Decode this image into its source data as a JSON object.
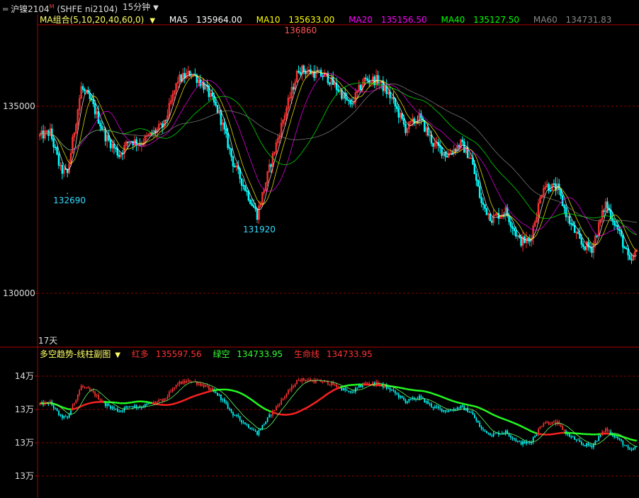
{
  "header": {
    "symbol_icon": "chain-link-icon",
    "title": "沪镍2104",
    "title_mark": "M",
    "exchange_code": "(SHFE ni2104)",
    "period": "15分钟",
    "period_dropdown_icon": "chevron-down-icon"
  },
  "ma_indicator": {
    "name": "MA组合(5,10,20,40,60,0)",
    "items": [
      {
        "label": "MA5",
        "value": "135964.00",
        "color": "#ffffff"
      },
      {
        "label": "MA10",
        "value": "135633.00",
        "color": "#ffff00"
      },
      {
        "label": "MA20",
        "value": "135156.50",
        "color": "#ff00ff"
      },
      {
        "label": "MA40",
        "value": "135127.50",
        "color": "#00ff00"
      },
      {
        "label": "MA60",
        "value": "134731.83",
        "color": "#888888"
      }
    ]
  },
  "main_axis": {
    "ticks": [
      {
        "value": 135000,
        "label": "135000"
      },
      {
        "value": 130000,
        "label": "130000"
      }
    ]
  },
  "annotations": {
    "high": {
      "label": "136860",
      "value": 136860
    },
    "low1": {
      "label": "132690",
      "value": 132690
    },
    "low2": {
      "label": "131920",
      "value": 131920
    },
    "days": "17天"
  },
  "sub_indicator": {
    "name": "多空趋势-线柱副图",
    "items": [
      {
        "label": "红多",
        "value": "135597.56",
        "color": "#ff3333"
      },
      {
        "label": "绿空",
        "value": "134733.95",
        "color": "#33ff33"
      },
      {
        "label": "生命线",
        "value": "134733.95",
        "color": "#ff3333"
      }
    ],
    "axis_labels": [
      "14万",
      "13万",
      "13万",
      "13万"
    ]
  },
  "colors": {
    "up": "#ff3333",
    "down": "#00ffff",
    "grid": "#8b0000",
    "axis": "#b00000"
  },
  "chart_data": {
    "type": "candlestick",
    "ylim": [
      129800,
      137000
    ],
    "waypoints": [
      [
        0,
        134200
      ],
      [
        6,
        134300
      ],
      [
        12,
        133300
      ],
      [
        16,
        133200
      ],
      [
        24,
        135500
      ],
      [
        30,
        135100
      ],
      [
        38,
        134200
      ],
      [
        46,
        133700
      ],
      [
        52,
        134100
      ],
      [
        58,
        134000
      ],
      [
        66,
        134300
      ],
      [
        72,
        134500
      ],
      [
        80,
        135700
      ],
      [
        88,
        135900
      ],
      [
        96,
        135500
      ],
      [
        104,
        134800
      ],
      [
        112,
        133500
      ],
      [
        120,
        132700
      ],
      [
        126,
        132100
      ],
      [
        134,
        133500
      ],
      [
        142,
        134800
      ],
      [
        150,
        136000
      ],
      [
        158,
        135900
      ],
      [
        166,
        135800
      ],
      [
        174,
        135400
      ],
      [
        180,
        135000
      ],
      [
        188,
        135700
      ],
      [
        196,
        135700
      ],
      [
        204,
        135200
      ],
      [
        212,
        134400
      ],
      [
        220,
        134700
      ],
      [
        228,
        134000
      ],
      [
        236,
        133700
      ],
      [
        244,
        134000
      ],
      [
        250,
        133600
      ],
      [
        256,
        132400
      ],
      [
        262,
        132000
      ],
      [
        270,
        132200
      ],
      [
        278,
        131400
      ],
      [
        284,
        131400
      ],
      [
        292,
        132900
      ],
      [
        300,
        132800
      ],
      [
        306,
        132000
      ],
      [
        314,
        131300
      ],
      [
        320,
        131200
      ],
      [
        328,
        132400
      ],
      [
        336,
        131600
      ],
      [
        342,
        130800
      ],
      [
        346,
        131100
      ]
    ]
  }
}
